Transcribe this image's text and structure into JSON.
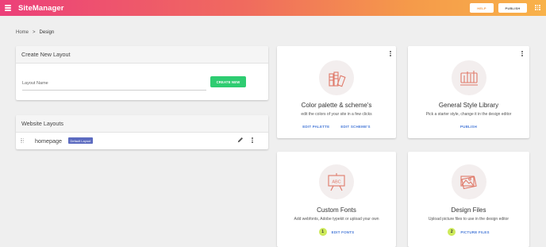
{
  "topbar": {
    "brand": "SiteManager",
    "help_label": "HELP",
    "publish_label": "PUBLISH",
    "colors": {
      "gradient_start": "#ec407a",
      "gradient_end": "#f8b24a"
    }
  },
  "breadcrumb": {
    "home": "Home",
    "separator": ">",
    "current": "Design"
  },
  "create_layout": {
    "title": "Create New Layout",
    "input_placeholder": "Layout Name",
    "button_label": "CREATE NEW"
  },
  "website_layouts": {
    "title": "Website Layouts",
    "items": [
      {
        "name": "homepage",
        "badge": "Default Layout"
      }
    ]
  },
  "features": {
    "color_palette": {
      "title": "Color palette & scheme's",
      "description": "edit the colors of your site in a few clicks",
      "actions": [
        "EDIT PALETTE",
        "EDIT SCHEME'S"
      ]
    },
    "style_library": {
      "title": "General Style Library",
      "description": "Pick a starter style, change it in the design editor",
      "actions": [
        "PUBLISH"
      ]
    },
    "custom_fonts": {
      "title": "Custom Fonts",
      "description": "Add webfonts, Adobe typekit or upload your own",
      "step": "1",
      "action": "EDIT FONTS"
    },
    "design_files": {
      "title": "Design Files",
      "description": "Upload picture files to use in the design editor",
      "step": "2",
      "action": "PICTURE FILES"
    }
  }
}
